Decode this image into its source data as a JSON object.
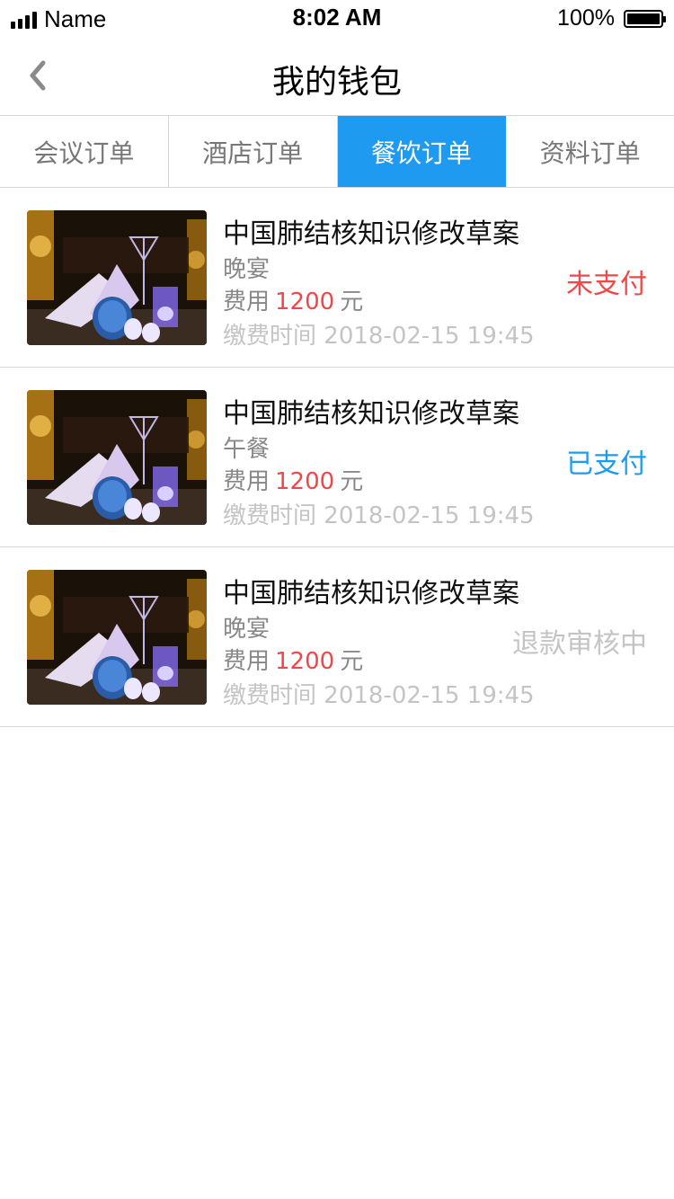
{
  "status_bar": {
    "carrier": "Name",
    "time": "8:02 AM",
    "battery": "100%",
    "signal_icon": "signal-bars-icon",
    "battery_icon": "battery-icon"
  },
  "nav": {
    "title": "我的钱包",
    "back_icon": "chevron-left-icon"
  },
  "tabs": [
    {
      "label": "会议订单",
      "active": false
    },
    {
      "label": "酒店订单",
      "active": false
    },
    {
      "label": "餐饮订单",
      "active": true
    },
    {
      "label": "资料订单",
      "active": false
    }
  ],
  "orders": [
    {
      "title": "中国肺结核知识修改草案",
      "meal": "晚宴",
      "fee_label": "费用",
      "fee_amount": "1200",
      "fee_unit": "元",
      "time_label": "缴费时间",
      "time": "2018-02-15 19:45",
      "status": "未支付"
    },
    {
      "title": "中国肺结核知识修改草案",
      "meal": "午餐",
      "fee_label": "费用",
      "fee_amount": "1200",
      "fee_unit": "元",
      "time_label": "缴费时间",
      "time": "2018-02-15 19:45",
      "status": "已支付"
    },
    {
      "title": "中国肺结核知识修改草案",
      "meal": "晚宴",
      "fee_label": "费用",
      "fee_amount": "1200",
      "fee_unit": "元",
      "time_label": "缴费时间",
      "time": "2018-02-15 19:45",
      "status": "退款审核中"
    }
  ],
  "colors": {
    "accent": "#1e9bf0",
    "unpaid": "#f04848",
    "muted": "#c4c4c4"
  }
}
